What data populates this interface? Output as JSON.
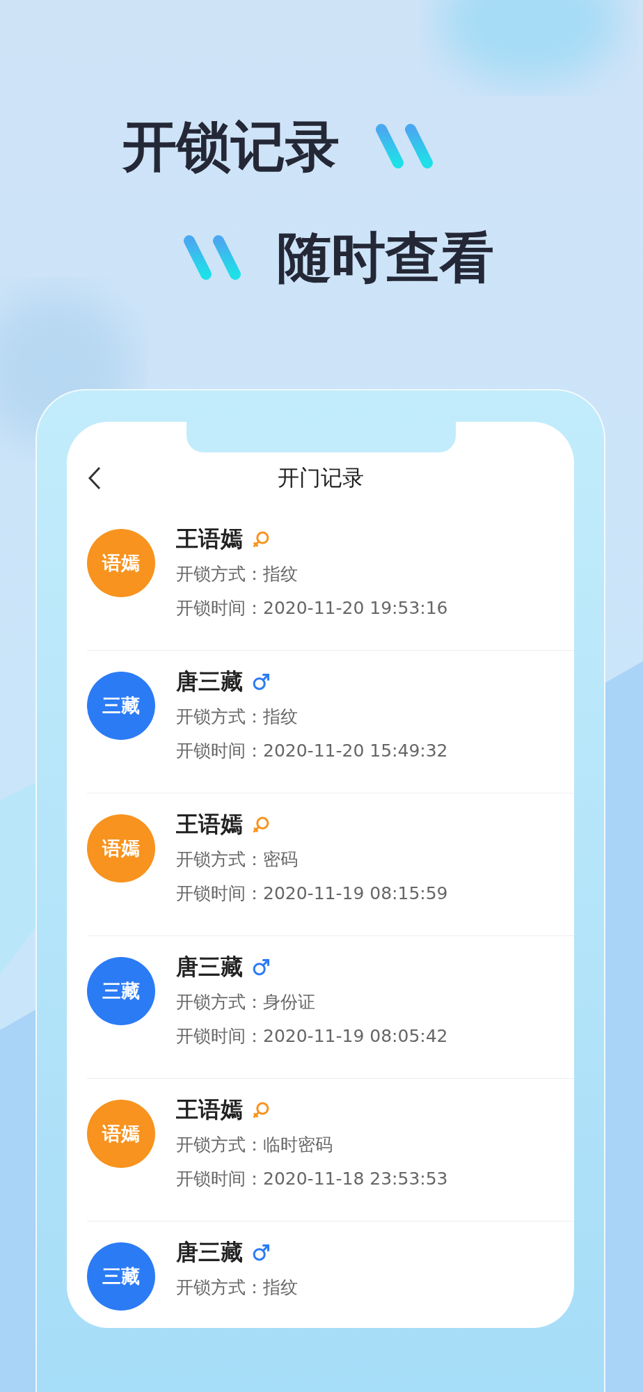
{
  "headline": [
    "开锁记录",
    "随时查看"
  ],
  "nav": {
    "title": "开门记录"
  },
  "records": [
    {
      "avatar": "语嫣",
      "color": "#f7931e",
      "name": "王语嫣",
      "kind": "female",
      "method": "开锁方式：指纹",
      "time": "开锁时间：2020-11-20 19:53:16"
    },
    {
      "avatar": "三藏",
      "color": "#2b7bf5",
      "name": "唐三藏",
      "kind": "male",
      "method": "开锁方式：指纹",
      "time": "开锁时间：2020-11-20 15:49:32"
    },
    {
      "avatar": "语嫣",
      "color": "#f7931e",
      "name": "王语嫣",
      "kind": "female",
      "method": "开锁方式：密码",
      "time": "开锁时间：2020-11-19 08:15:59"
    },
    {
      "avatar": "三藏",
      "color": "#2b7bf5",
      "name": "唐三藏",
      "kind": "male",
      "method": "开锁方式：身份证",
      "time": "开锁时间：2020-11-19 08:05:42"
    },
    {
      "avatar": "语嫣",
      "color": "#f7931e",
      "name": "王语嫣",
      "kind": "female",
      "method": "开锁方式：临时密码",
      "time": "开锁时间：2020-11-18 23:53:53"
    },
    {
      "avatar": "三藏",
      "color": "#2b7bf5",
      "name": "唐三藏",
      "kind": "male",
      "method": "开锁方式：指纹"
    }
  ]
}
